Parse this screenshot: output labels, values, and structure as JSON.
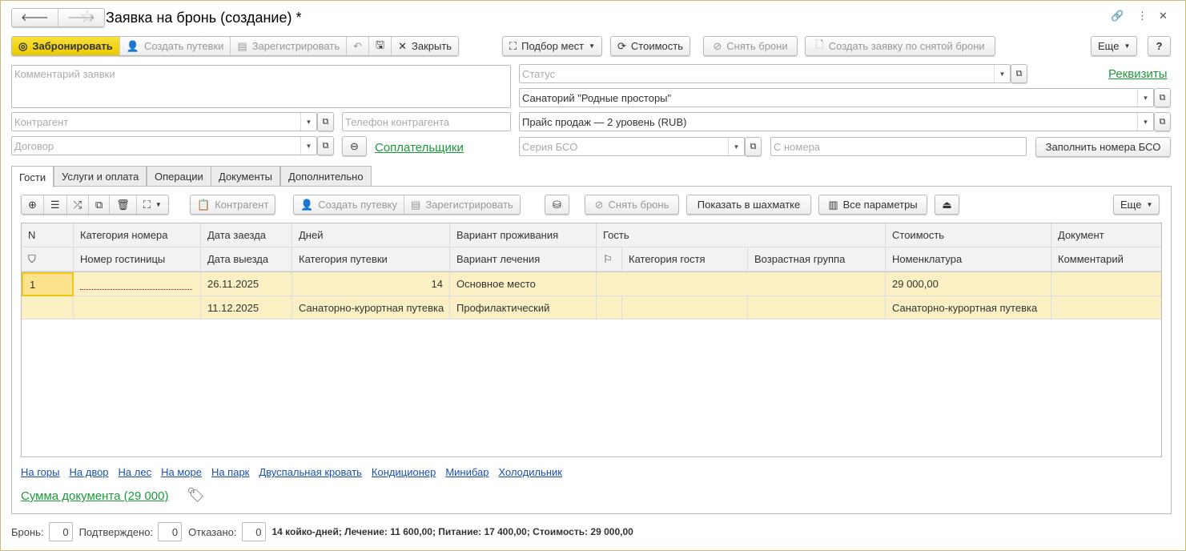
{
  "title": "Заявка на бронь (создание) *",
  "toolbar": {
    "book": "Забронировать",
    "create_vouchers": "Создать путевки",
    "register": "Зарегистрировать",
    "close": "Закрыть",
    "pick_places": "Подбор мест",
    "cost": "Стоимость",
    "remove_bookings": "Снять брони",
    "create_from_removed": "Создать заявку по снятой брони",
    "more": "Еще",
    "help": "?"
  },
  "form": {
    "comment_placeholder": "Комментарий заявки",
    "contractor_placeholder": "Контрагент",
    "phone_placeholder": "Телефон контрагента",
    "contract_placeholder": "Договор",
    "copayers": "Соплательщики",
    "status_placeholder": "Статус",
    "requisites": "Реквизиты",
    "sanatorium": "Санаторий \"Родные просторы\"",
    "price": "Прайс продаж — 2 уровень (RUB)",
    "bso_series_placeholder": "Серия БСО",
    "from_number_placeholder": "С номера",
    "fill_bso": "Заполнить номера БСО"
  },
  "tabs": [
    "Гости",
    "Услуги и оплата",
    "Операции",
    "Документы",
    "Дополнительно"
  ],
  "grid_toolbar": {
    "contractor": "Контрагент",
    "create_voucher": "Создать путевку",
    "register": "Зарегистрировать",
    "remove_booking": "Снять бронь",
    "show_chess": "Показать в шахматке",
    "all_params": "Все параметры",
    "more": "Еще"
  },
  "grid": {
    "header1": [
      "N",
      "Категория номера",
      "Дата заезда",
      "Дней",
      "Вариант проживания",
      "Гость",
      "Стоимость",
      "Документ"
    ],
    "header2": [
      "Номер гостиницы",
      "Дата выезда",
      "Категория путевки",
      "Вариант лечения",
      "Категория гостя",
      "Возрастная группа",
      "Номенклатура",
      "Комментарий"
    ],
    "row1": {
      "n": "1",
      "room_cat": "",
      "arrival": "26.11.2025",
      "days": "14",
      "accommodation": "Основное место",
      "cost": "29 000,00"
    },
    "row2": {
      "departure": "11.12.2025",
      "voucher_cat": "Санаторно-курортная путевка",
      "treatment": "Профилактический",
      "nomenclature": "Санаторно-курортная путевка"
    }
  },
  "tags": [
    "На горы",
    "На двор",
    "На лес",
    "На море",
    "На парк",
    "Двуспальная кровать",
    "Кондиционер",
    "Минибар",
    "Холодильник"
  ],
  "sum_link": "Сумма документа (29 000)",
  "footer": {
    "booked_label": "Бронь:",
    "booked": "0",
    "confirmed_label": "Подтверждено:",
    "confirmed": "0",
    "refused_label": "Отказано:",
    "refused": "0",
    "summary": "14 койко-дней; Лечение: 11 600,00; Питание: 17 400,00; Стоимость: 29 000,00"
  }
}
